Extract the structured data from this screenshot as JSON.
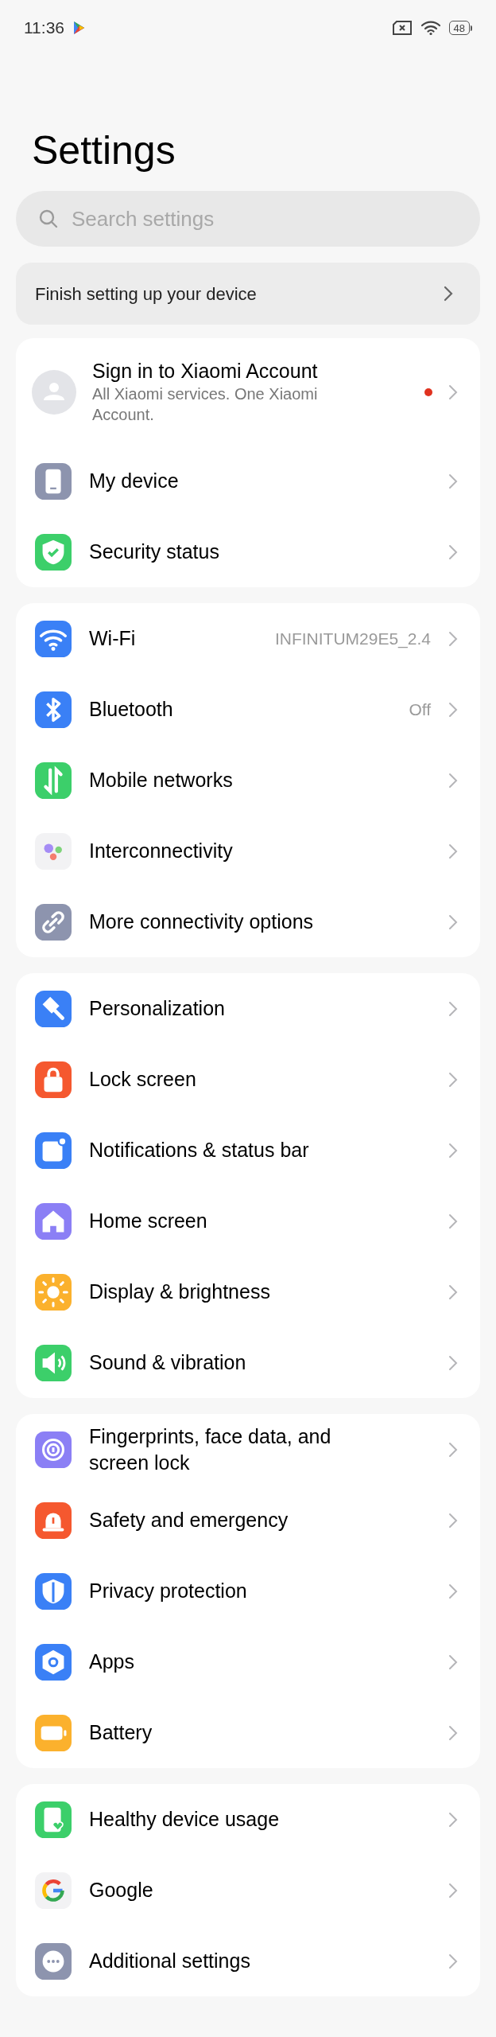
{
  "status_bar": {
    "time": "11:36",
    "battery": "48"
  },
  "title": "Settings",
  "search": {
    "placeholder": "Search settings"
  },
  "setup_banner": {
    "label": "Finish setting up your device"
  },
  "account": {
    "title": "Sign in to Xiaomi Account",
    "subtitle": "All Xiaomi services. One Xiaomi Account.",
    "notification_dot": true
  },
  "sections": [
    {
      "items": [
        {
          "label": "My device",
          "color": "#8d94ae"
        },
        {
          "label": "Security status",
          "color": "#3ccf6a"
        }
      ]
    },
    {
      "items": [
        {
          "label": "Wi-Fi",
          "value": "INFINITUM29E5_2.4",
          "color": "#3a80f6"
        },
        {
          "label": "Bluetooth",
          "value": "Off",
          "color": "#3a80f6"
        },
        {
          "label": "Mobile networks",
          "color": "#3ccf6a"
        },
        {
          "label": "Interconnectivity",
          "color": "#f2f2f4"
        },
        {
          "label": "More connectivity options",
          "color": "#8d94ae"
        }
      ]
    },
    {
      "items": [
        {
          "label": "Personalization",
          "color": "#3a80f6"
        },
        {
          "label": "Lock screen",
          "color": "#f5582f"
        },
        {
          "label": "Notifications & status bar",
          "color": "#3a80f6"
        },
        {
          "label": "Home screen",
          "color": "#8b7ff5"
        },
        {
          "label": "Display & brightness",
          "color": "#fbb12d"
        },
        {
          "label": "Sound & vibration",
          "color": "#3ccf6a"
        }
      ]
    },
    {
      "items": [
        {
          "label": "Fingerprints, face data, and screen lock",
          "color": "#8b7ff5"
        },
        {
          "label": "Safety and emergency",
          "color": "#f5582f"
        },
        {
          "label": "Privacy protection",
          "color": "#3a80f6"
        },
        {
          "label": "Apps",
          "color": "#3a80f6"
        },
        {
          "label": "Battery",
          "color": "#fbb12d"
        }
      ]
    },
    {
      "items": [
        {
          "label": "Healthy device usage",
          "color": "#3ccf6a"
        },
        {
          "label": "Google",
          "color": "#f2f2f4"
        },
        {
          "label": "Additional settings",
          "color": "#8d94ae"
        }
      ]
    }
  ]
}
